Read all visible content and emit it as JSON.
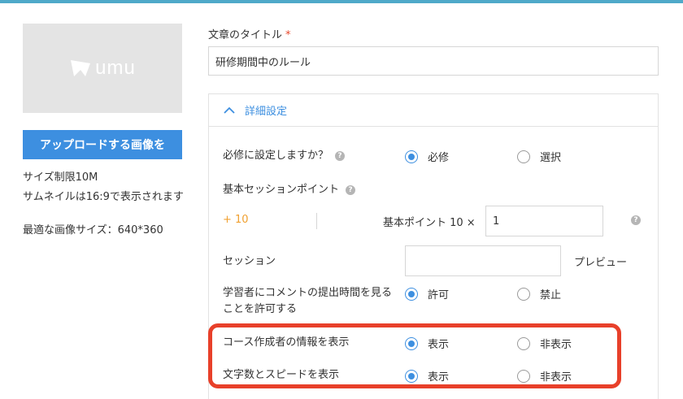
{
  "colors": {
    "accent": "#3d8fe0",
    "required": "#e8492d",
    "highlight": "#e8402a",
    "points": "#f0a030",
    "topbar": "#4fa9c9"
  },
  "thumbnail": {
    "logo_text": "umu",
    "logo_icon": "umu-logo-icon"
  },
  "upload": {
    "button_label": "アップロードする画像を",
    "size_limit": "サイズ制限10M",
    "ratio_note": "サムネイルは16:9で表示されます",
    "best_size": "最適な画像サイズ：640*360"
  },
  "title_field": {
    "label": "文章のタイトル",
    "required_mark": "*",
    "value": "研修期間中のルール"
  },
  "details": {
    "header": "詳細設定",
    "required": {
      "label": "必修に設定しますか？",
      "option_on": "必修",
      "option_off": "選択",
      "selected": "必修"
    },
    "points": {
      "label": "基本セッションポイント",
      "bonus": "+ 10",
      "base_label": "基本ポイント 10 ×",
      "multiplier": "1"
    },
    "session": {
      "label": "セッション",
      "value": "",
      "preview": "プレビュー"
    },
    "comment_time": {
      "label": "学習者にコメントの提出時間を見ることを許可する",
      "option_on": "許可",
      "option_off": "禁止",
      "selected": "許可"
    },
    "author_info": {
      "label": "コース作成者の情報を表示",
      "option_on": "表示",
      "option_off": "非表示",
      "selected": "表示"
    },
    "word_count": {
      "label": "文字数とスピードを表示",
      "option_on": "表示",
      "option_off": "非表示",
      "selected": "表示"
    }
  },
  "help_icon": "?"
}
